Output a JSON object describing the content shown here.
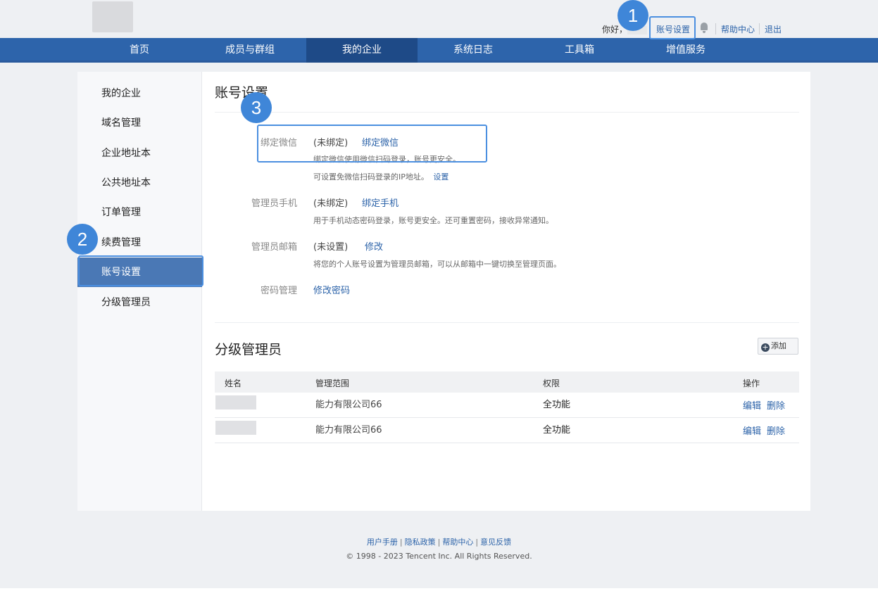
{
  "header": {
    "greeting": "你好，",
    "account_settings": "账号设置",
    "help_center": "帮助中心",
    "logout": "退出"
  },
  "nav": {
    "items": [
      "首页",
      "成员与群组",
      "我的企业",
      "系统日志",
      "工具箱",
      "增值服务"
    ],
    "active": "我的企业"
  },
  "sidebar": {
    "items": [
      "我的企业",
      "域名管理",
      "企业地址本",
      "公共地址本",
      "订单管理",
      "续费管理",
      "账号设置",
      "分级管理员"
    ],
    "active": "账号设置"
  },
  "account": {
    "title": "账号设置",
    "wechat": {
      "label": "绑定微信",
      "status": "(未绑定)",
      "action": "绑定微信",
      "desc1": "绑定微信使用微信扫码登录，账号更安全。",
      "desc2": "可设置免微信扫码登录的IP地址。",
      "desc2_link": "设置"
    },
    "phone": {
      "label": "管理员手机",
      "status": "(未绑定)",
      "action": "绑定手机",
      "desc": "用于手机动态密码登录，账号更安全。还可重置密码，接收异常通知。"
    },
    "email": {
      "label": "管理员邮箱",
      "status": "(未设置)",
      "action": "修改",
      "desc": "将您的个人账号设置为管理员邮箱，可以从邮箱中一键切换至管理页面。"
    },
    "password": {
      "label": "密码管理",
      "action": "修改密码"
    }
  },
  "admins": {
    "title": "分级管理员",
    "add_button": "添加",
    "columns": [
      "姓名",
      "管理范围",
      "权限",
      "操作"
    ],
    "rows": [
      {
        "scope": "能力有限公司66",
        "permission": "全功能",
        "edit": "编辑",
        "delete": "删除"
      },
      {
        "scope": "能力有限公司66",
        "permission": "全功能",
        "edit": "编辑",
        "delete": "删除"
      }
    ]
  },
  "footer": {
    "links": [
      "用户手册",
      "隐私政策",
      "帮助中心",
      "意见反馈"
    ],
    "separator": "|",
    "copyright": "© 1998 - 2023 Tencent Inc. All Rights Reserved."
  },
  "annotations": [
    "1",
    "2",
    "3"
  ],
  "colors": {
    "nav_bg": "#2d64ab",
    "nav_active": "#1e4a87",
    "sidebar_active": "#4a78b5",
    "link": "#2c63a9",
    "callout": "#3f86d8"
  }
}
